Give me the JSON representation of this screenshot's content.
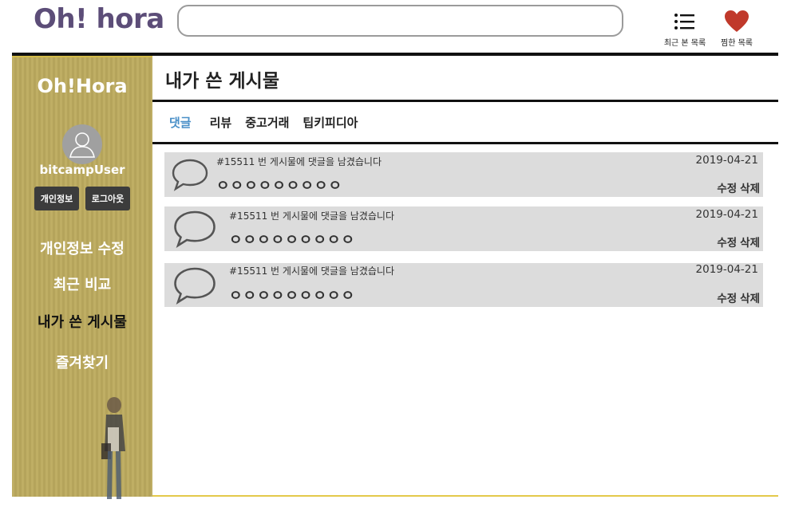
{
  "header": {
    "logo": "Oh! hora",
    "search_value": "",
    "recent_label": "최근 본 목록",
    "wishlist_label": "찜한 목록"
  },
  "sidebar": {
    "title": "Oh!Hora",
    "username": "bitcampUser",
    "profile_button": "개인정보",
    "logout_button": "로그아웃",
    "menu": [
      {
        "label": "개인정보 수정"
      },
      {
        "label": "최근 비교"
      },
      {
        "label": "내가 쓴 게시물"
      },
      {
        "label": "즐겨찾기"
      }
    ],
    "active_menu": "내가 쓴 게시물"
  },
  "main": {
    "title": "내가 쓴 게시물",
    "tabs": [
      {
        "label": "댓글"
      },
      {
        "label": "리뷰"
      },
      {
        "label": "중고거래"
      },
      {
        "label": "팁키피디아"
      }
    ],
    "active_tab": "댓글",
    "comments": [
      {
        "post": "#15511 번 게시물에 댓글을 남겼습니다",
        "body": "ㅇㅇㅇㅇㅇㅇㅇㅇㅇ",
        "date": "2019-04-21",
        "edit": "수정",
        "delete": "삭제"
      },
      {
        "post": "#15511 번 게시물에 댓글을 남겼습니다",
        "body": "ㅇㅇㅇㅇㅇㅇㅇㅇㅇ",
        "date": "2019-04-21",
        "edit": "수정",
        "delete": "삭제"
      },
      {
        "post": "#15511 번 게시물에 댓글을 남겼습니다",
        "body": "ㅇㅇㅇㅇㅇㅇㅇㅇㅇ",
        "date": "2019-04-21",
        "edit": "수정",
        "delete": "삭제"
      }
    ]
  },
  "colors": {
    "logo": "#5c4d78",
    "sidebar": "#bfae64",
    "active_tab": "#4a90c8",
    "heart": "#c0392b",
    "comment_bg": "#dcdcdc"
  },
  "icons": {
    "recent": "list-icon",
    "wishlist": "heart-icon",
    "comment": "speech-bubble-icon",
    "avatar": "user-icon"
  }
}
